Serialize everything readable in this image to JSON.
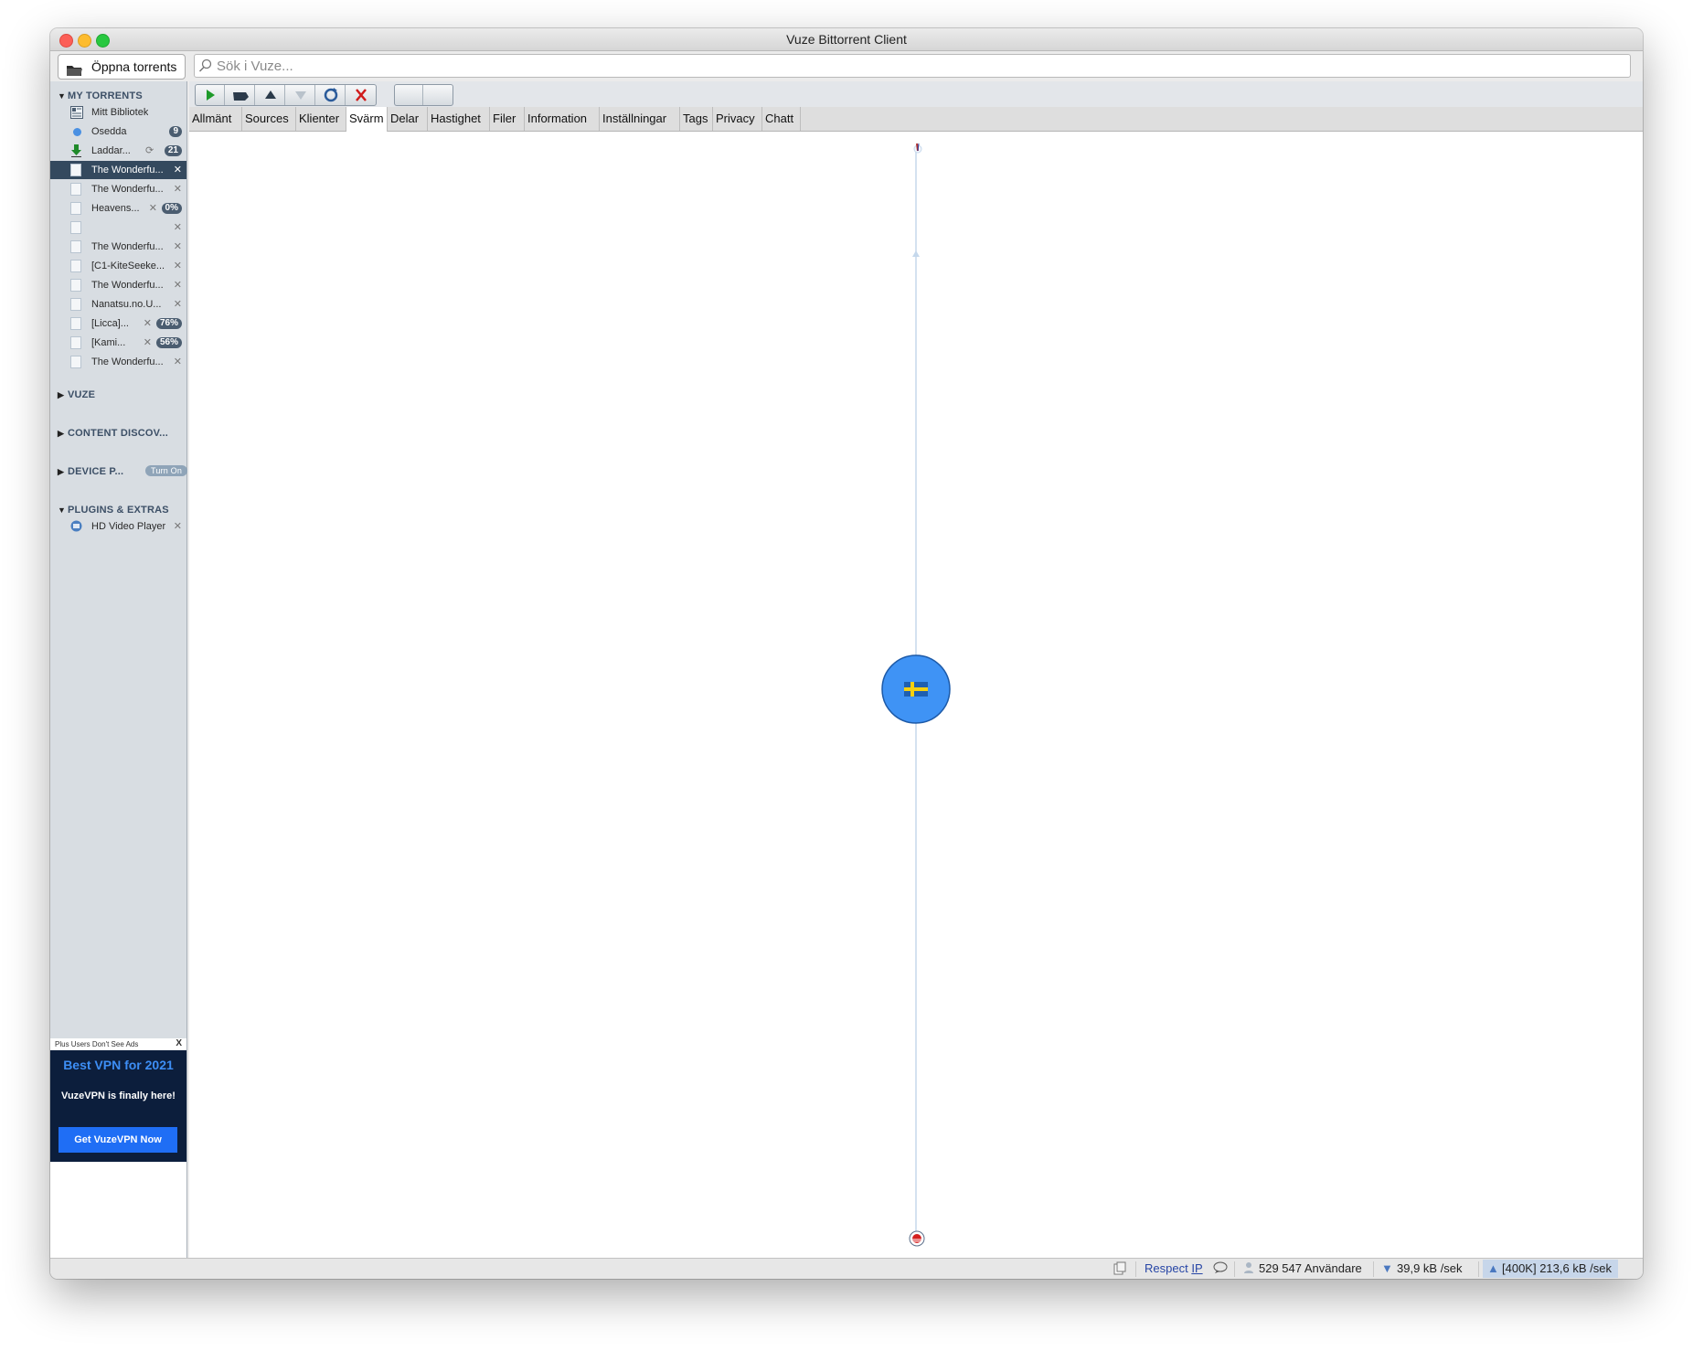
{
  "window": {
    "title": "Vuze Bittorrent Client"
  },
  "topbar": {
    "open_label": "Öppna torrents",
    "search_placeholder": "Sök i Vuze..."
  },
  "sidebar": {
    "my_torrents": {
      "header": "MY TORRENTS",
      "library": "Mitt Bibliotek",
      "unseen": {
        "label": "Osedda",
        "count": "9"
      },
      "downloading": {
        "label": "Laddar...",
        "count": "21"
      },
      "items": [
        {
          "label": "The Wonderfu...",
          "badge": ""
        },
        {
          "label": "The Wonderfu...",
          "badge": ""
        },
        {
          "label": "Heavens...",
          "badge": "0%"
        },
        {
          "label": "",
          "badge": ""
        },
        {
          "label": "The Wonderfu...",
          "badge": ""
        },
        {
          "label": "[C1-KiteSeeke...",
          "badge": ""
        },
        {
          "label": "The Wonderfu...",
          "badge": ""
        },
        {
          "label": "Nanatsu.no.U...",
          "badge": ""
        },
        {
          "label": "[Licca]...",
          "badge": "76%"
        },
        {
          "label": "[Kami...",
          "badge": "56%"
        },
        {
          "label": "The Wonderfu...",
          "badge": ""
        }
      ]
    },
    "vuze": {
      "header": "VUZE"
    },
    "content_discovery": {
      "header": "CONTENT DISCOV..."
    },
    "device": {
      "header": "DEVICE P...",
      "pill": "Turn On"
    },
    "plugins": {
      "header": "PLUGINS & EXTRAS",
      "item": "HD Video Player"
    },
    "ad": {
      "note": "Plus Users Don't See Ads",
      "close": "X",
      "title": "Best VPN for 2021",
      "subtitle": "VuzeVPN is finally here!",
      "button": "Get VuzeVPN Now"
    }
  },
  "tabs": [
    "Allmänt",
    "Sources",
    "Klienter",
    "Svärm",
    "Delar",
    "Hastighet",
    "Filer",
    "Information",
    "Inställningar",
    "Tags",
    "Privacy",
    "Chatt"
  ],
  "active_tab": "Svärm",
  "swarm": {
    "center_flag": "Sweden",
    "center_color": "#3f93f5"
  },
  "statusbar": {
    "respect": "Respect",
    "ip": "IP",
    "users": "529 547 Användare",
    "download": "39,9 kB /sek",
    "upload": "[400K] 213,6 kB /sek"
  },
  "icons": [
    "folder-icon",
    "search-icon",
    "library-icon",
    "unseen-dot-icon",
    "download-arrow-icon",
    "refresh-icon",
    "document-icon",
    "plugin-icon",
    "play-icon",
    "stop-icon",
    "up-icon",
    "down-icon",
    "refresh-queue-icon",
    "remove-icon",
    "copy-icon",
    "chat-icon",
    "users-icon",
    "download-speed-icon",
    "upload-speed-icon"
  ]
}
